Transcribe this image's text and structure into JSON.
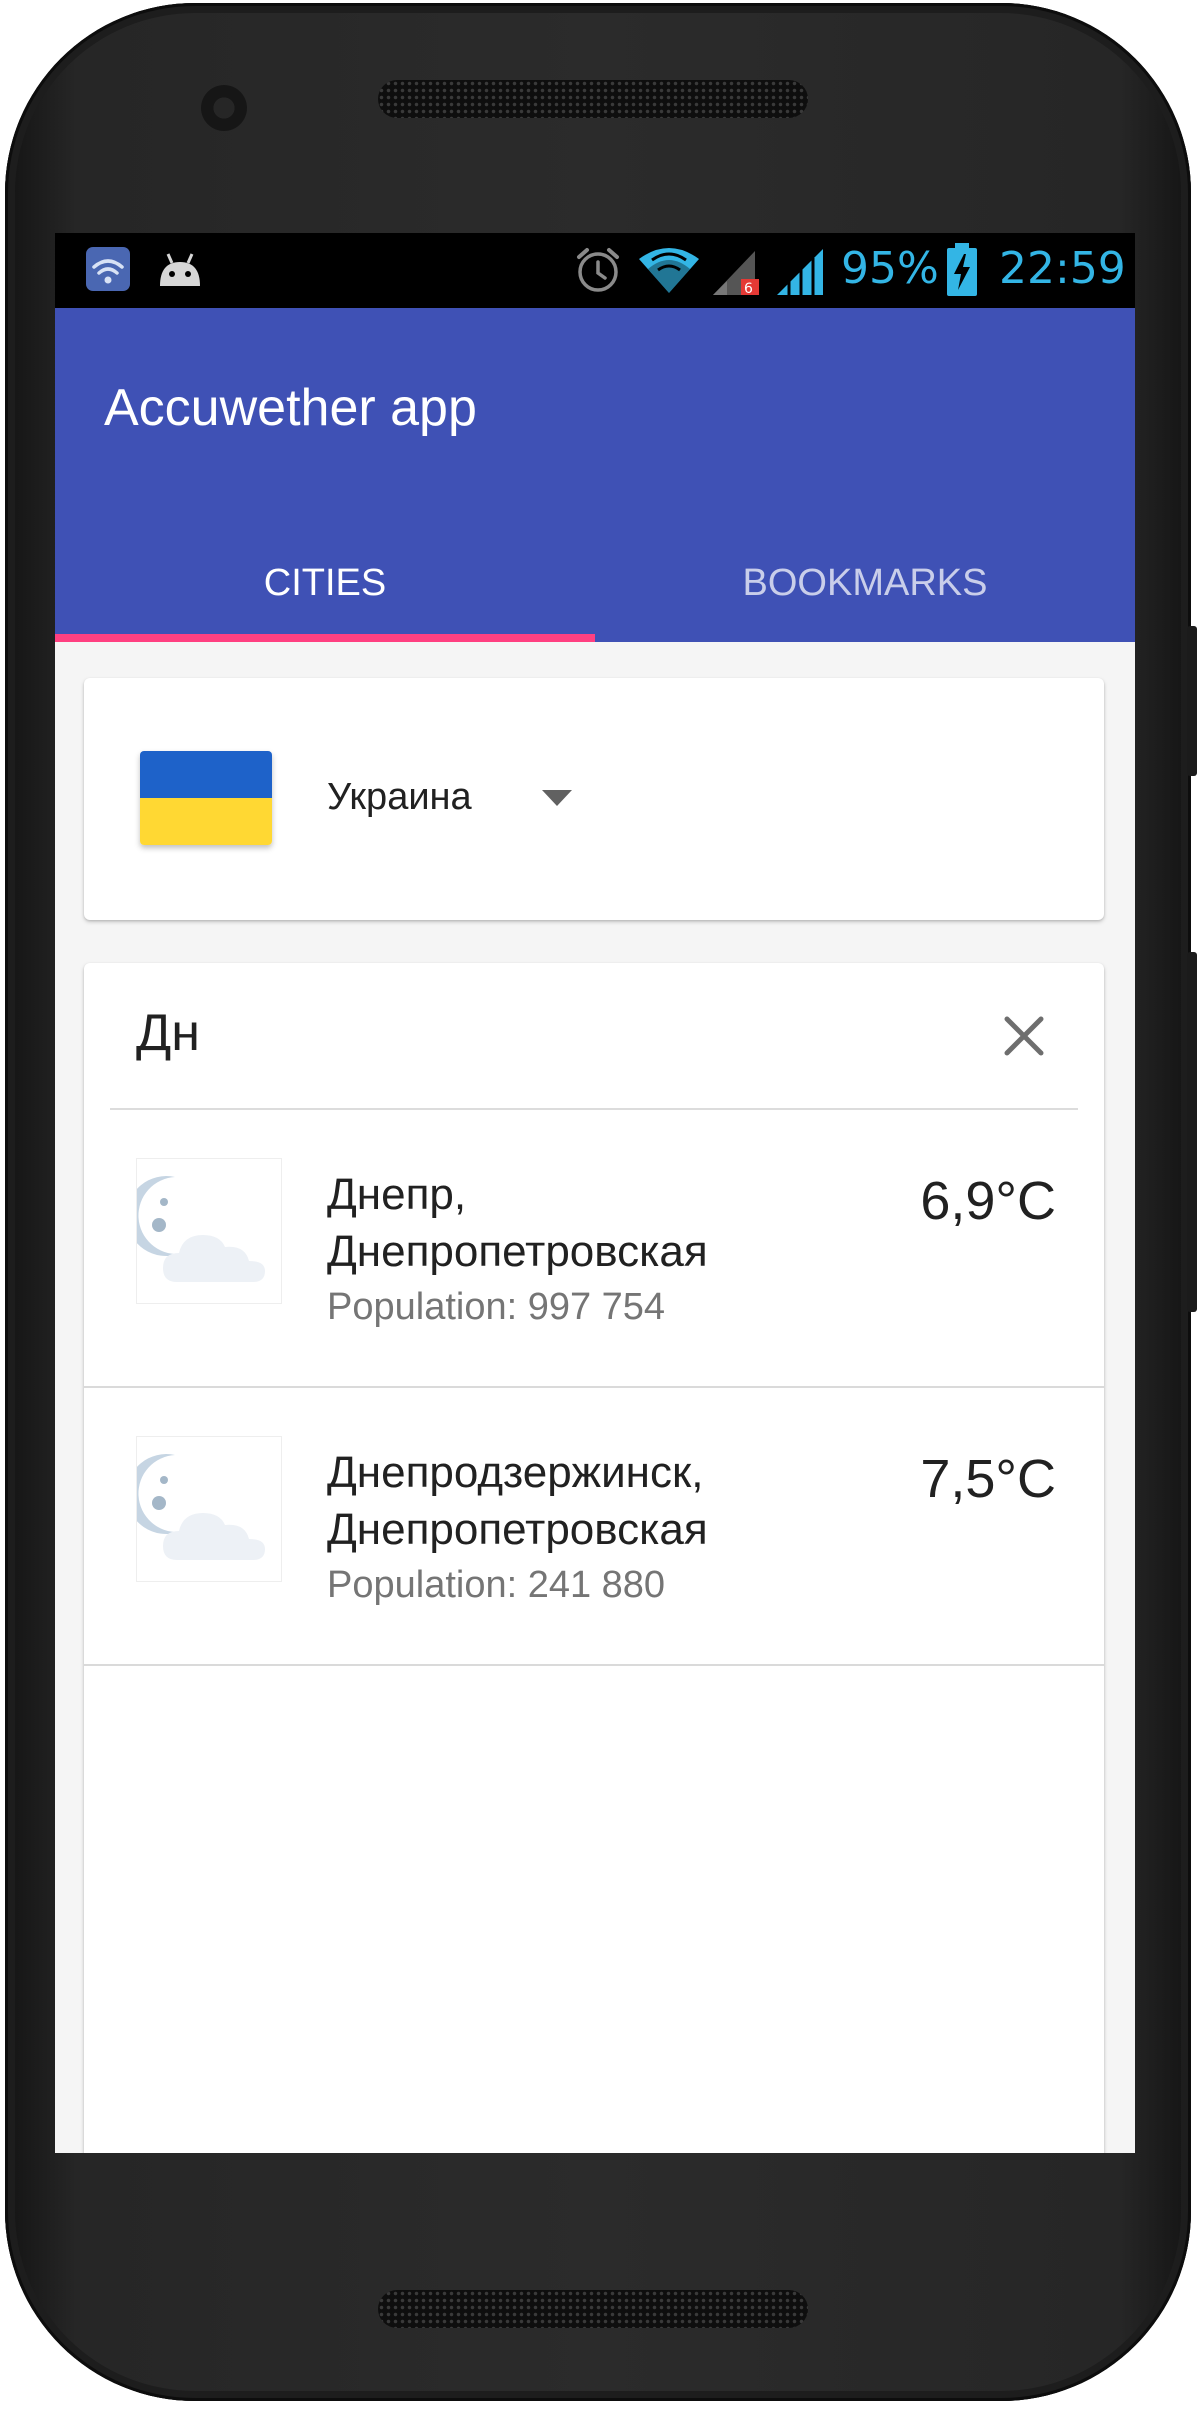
{
  "status_bar": {
    "battery": "95%",
    "time": "22:59",
    "icons": [
      "wifi-notification-icon",
      "android-debug-icon",
      "alarm-icon",
      "wifi-signal-icon",
      "cellular-signal-icon-sim1",
      "cellular-signal-icon-sim2",
      "battery-charging-icon"
    ],
    "accent_color": "#33b5e5"
  },
  "app_bar": {
    "title": "Accuwether app",
    "color": "#3f51b5",
    "tabs": [
      {
        "label": "CITIES",
        "selected": true
      },
      {
        "label": "BOOKMARKS",
        "selected": false
      }
    ],
    "indicator_color": "#ff4081"
  },
  "country_selector": {
    "flag": "ukraine-flag",
    "selected_country": "Украина"
  },
  "search": {
    "query": "Дн",
    "clear_icon": "close-icon"
  },
  "cities": [
    {
      "icon": "night-partly-cloudy-icon",
      "name_line1": "Днепр,",
      "name_line2": "Днепропетровская",
      "population": "Population: 997 754",
      "temperature": "6,9°C"
    },
    {
      "icon": "night-partly-cloudy-icon",
      "name_line1": "Днепродзержинск,",
      "name_line2": "Днепропетровская",
      "population": "Population: 241 880",
      "temperature": "7,5°C"
    }
  ]
}
